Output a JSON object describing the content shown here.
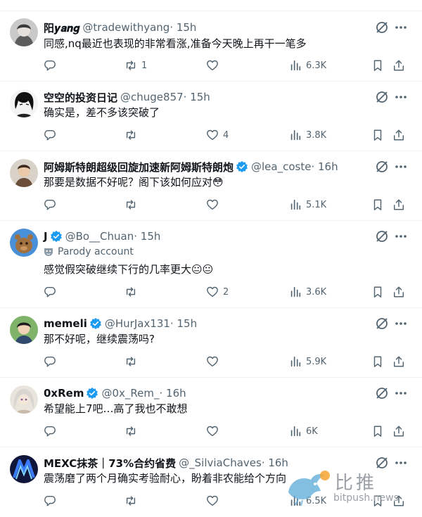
{
  "icons": {
    "reply": "reply-icon",
    "retweet": "retweet-icon",
    "like": "heart-icon",
    "views": "views-icon",
    "bookmark": "bookmark-icon",
    "share": "share-icon",
    "grok": "grok-icon",
    "more": "more-icon",
    "verified": "verified-badge-icon"
  },
  "colors": {
    "verified": "#1d9bf0",
    "muted": "#536471",
    "text": "#0f1419",
    "divider": "#eff3f4"
  },
  "tweets": [
    {
      "name": "阳𝒚𝒂𝒏𝒈",
      "verified": false,
      "handle": "@tradewithyang",
      "time": "· 15h",
      "text": "同感,nq最近也表现的非常看涨,准备今天晚上再干一笔多",
      "replies": "",
      "retweets": "1",
      "likes": "",
      "views": "6.3K"
    },
    {
      "name": "空空的投资日记",
      "verified": false,
      "handle": "@chuge857",
      "time": "· 15h",
      "text": "确实是，差不多该突破了",
      "replies": "",
      "retweets": "",
      "likes": "4",
      "views": "3.8K"
    },
    {
      "name": "阿姆斯特朗超级回旋加速新阿姆斯特朗炮",
      "verified": true,
      "handle": "@lea_coste",
      "time": "· 16h",
      "text": "那要是数据不好呢？阁下该如何应对😳",
      "replies": "",
      "retweets": "",
      "likes": "",
      "views": "5.1K"
    },
    {
      "name": "J",
      "verified": true,
      "handle": "@Bo__Chuan",
      "time": "· 15h",
      "parody": "Parody account",
      "text": "感觉假突破继续下行的几率更大😐😐",
      "replies": "",
      "retweets": "",
      "likes": "2",
      "views": "3.6K"
    },
    {
      "name": "memeli",
      "verified": true,
      "handle": "@HurJax131",
      "time": "· 15h",
      "text": "那不好呢，继续震荡吗?",
      "replies": "",
      "retweets": "",
      "likes": "",
      "views": "5.9K"
    },
    {
      "name": "0xRem",
      "verified": true,
      "handle": "@0x_Rem_",
      "time": "· 16h",
      "text": "希望能上7吧…高了我也不敢想",
      "replies": "",
      "retweets": "",
      "likes": "",
      "views": "6K"
    },
    {
      "name": "MEXC抹茶｜73%合约省费",
      "verified": false,
      "handle": "@_SilviaChaves",
      "time": "· 16h",
      "text": "震荡磨了两个月确实考验耐心，盼着非农能给个方向",
      "replies": "",
      "retweets": "",
      "likes": "",
      "views": "6.5K"
    }
  ],
  "watermark": {
    "brand": "比推",
    "site": "bitpush.news"
  }
}
